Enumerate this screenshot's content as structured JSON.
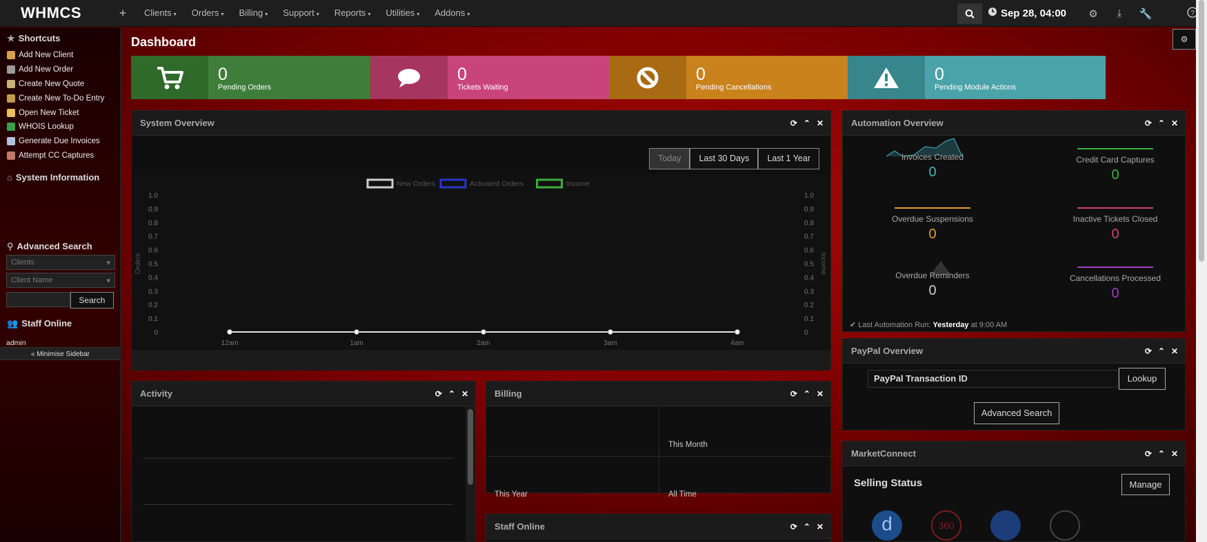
{
  "topnav": {
    "logo": "WHMCS",
    "add_icon": "plus-icon",
    "menu": [
      "Clients",
      "Orders",
      "Billing",
      "Support",
      "Reports",
      "Utilities",
      "Addons"
    ],
    "datetime": "Sep 28, 04:00",
    "icons": [
      "search-icon",
      "clock-icon",
      "gear-icon",
      "download-icon",
      "wrench-icon",
      "help-icon"
    ]
  },
  "sidebar": {
    "shortcuts_title": "Shortcuts",
    "shortcuts": [
      {
        "label": "Add New Client",
        "color": "#d7a04a"
      },
      {
        "label": "Add New Order",
        "color": "#9a9a9a"
      },
      {
        "label": "Create New Quote",
        "color": "#c8b27a"
      },
      {
        "label": "Create New To-Do Entry",
        "color": "#c49b4d"
      },
      {
        "label": "Open New Ticket",
        "color": "#e8c060"
      },
      {
        "label": "WHOIS Lookup",
        "color": "#3aa04a"
      },
      {
        "label": "Generate Due Invoices",
        "color": "#b0c4de"
      },
      {
        "label": "Attempt CC Captures",
        "color": "#c47a6a"
      }
    ],
    "system_info_title": "System Information",
    "advanced_search_title": "Advanced Search",
    "search_select_1": "Clients",
    "search_select_2": "Client Name",
    "search_button": "Search",
    "staff_online_title": "Staff Online",
    "staff_online_user": "admin",
    "minimise_label": "« Minimise Sidebar"
  },
  "dashboard": {
    "title": "Dashboard",
    "stats": [
      {
        "value": "0",
        "label": "Pending Orders",
        "icon": "cart-icon",
        "color": "#3f7d3a",
        "color_dark": "#2f6a2b"
      },
      {
        "value": "0",
        "label": "Tickets Waiting",
        "icon": "comment-icon",
        "color": "#c9447a",
        "color_dark": "#a6355f"
      },
      {
        "value": "0",
        "label": "Pending Cancellations",
        "icon": "ban-icon",
        "color": "#c9821c",
        "color_dark": "#a86a12"
      },
      {
        "value": "0",
        "label": "Pending Module Actions",
        "icon": "warning-icon",
        "color": "#4aa3a8",
        "color_dark": "#37868b"
      }
    ]
  },
  "system_overview": {
    "title": "System Overview",
    "ranges": [
      "Today",
      "Last 30 Days",
      "Last 1 Year"
    ],
    "legend": [
      {
        "name": "New Orders",
        "color": "#d0d0d0"
      },
      {
        "name": "Activated Orders",
        "color": "#2b35c9"
      },
      {
        "name": "Income",
        "color": "#3fae3f"
      }
    ]
  },
  "chart_data": {
    "type": "line",
    "x": [
      "12am",
      "1am",
      "2am",
      "3am",
      "4am"
    ],
    "series": [
      {
        "name": "New Orders",
        "values": [
          0,
          0,
          0,
          0,
          0
        ]
      },
      {
        "name": "Activated Orders",
        "values": [
          0,
          0,
          0,
          0,
          0
        ]
      },
      {
        "name": "Income",
        "values": [
          0,
          0,
          0,
          0,
          0
        ]
      }
    ],
    "ylabel": "Orders",
    "y2label": "Income",
    "ylim": [
      0,
      1.0
    ],
    "yticks": [
      "1.0",
      "0.9",
      "0.8",
      "0.7",
      "0.6",
      "0.5",
      "0.4",
      "0.3",
      "0.2",
      "0.1",
      "0"
    ],
    "legend_position": "top-center"
  },
  "automation": {
    "title": "Automation Overview",
    "cells": [
      {
        "label": "Invoices Created",
        "value": "0",
        "color": "#49b3c4"
      },
      {
        "label": "Credit Card Captures",
        "value": "0",
        "color": "#3fae3f"
      },
      {
        "label": "Overdue Suspensions",
        "value": "0",
        "color": "#e0a030"
      },
      {
        "label": "Inactive Tickets Closed",
        "value": "0",
        "color": "#d0407a"
      },
      {
        "label": "Overdue Reminders",
        "value": "0",
        "color": "#cccccc"
      },
      {
        "label": "Cancellations Processed",
        "value": "0",
        "color": "#9a3fc4"
      }
    ],
    "last_run_prefix": "Last Automation Run:",
    "last_run_day": "Yesterday",
    "last_run_time": "at 9:00 AM"
  },
  "paypal": {
    "title": "PayPal Overview",
    "input_placeholder": "PayPal Transaction ID",
    "lookup_button": "Lookup",
    "advanced_button": "Advanced Search"
  },
  "marketconnect": {
    "title": "MarketConnect",
    "selling_status": "Selling Status",
    "manage_button": "Manage"
  },
  "activity": {
    "title": "Activity"
  },
  "billing": {
    "title": "Billing",
    "this_month": "This Month",
    "this_year": "This Year",
    "all_time": "All Time"
  },
  "staff_online_panel": {
    "title": "Staff Online"
  }
}
